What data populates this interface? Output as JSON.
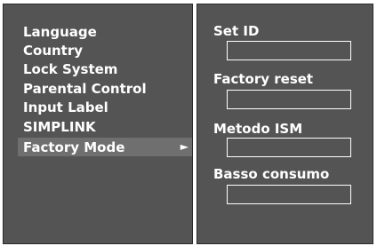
{
  "menu": {
    "items": [
      {
        "label": "Language"
      },
      {
        "label": "Country"
      },
      {
        "label": "Lock System"
      },
      {
        "label": "Parental Control"
      },
      {
        "label": "Input Label"
      },
      {
        "label": "SIMPLINK"
      },
      {
        "label": "Factory Mode",
        "selected": true
      }
    ],
    "selected_arrow": "►"
  },
  "submenu": {
    "fields": [
      {
        "label": "Set ID",
        "value": ""
      },
      {
        "label": "Factory reset",
        "value": ""
      },
      {
        "label": "Metodo ISM",
        "value": ""
      },
      {
        "label": "Basso consumo",
        "value": ""
      }
    ]
  },
  "colors": {
    "panel": "#545454",
    "highlight": "#6f6f6f",
    "text": "#ffffff"
  }
}
